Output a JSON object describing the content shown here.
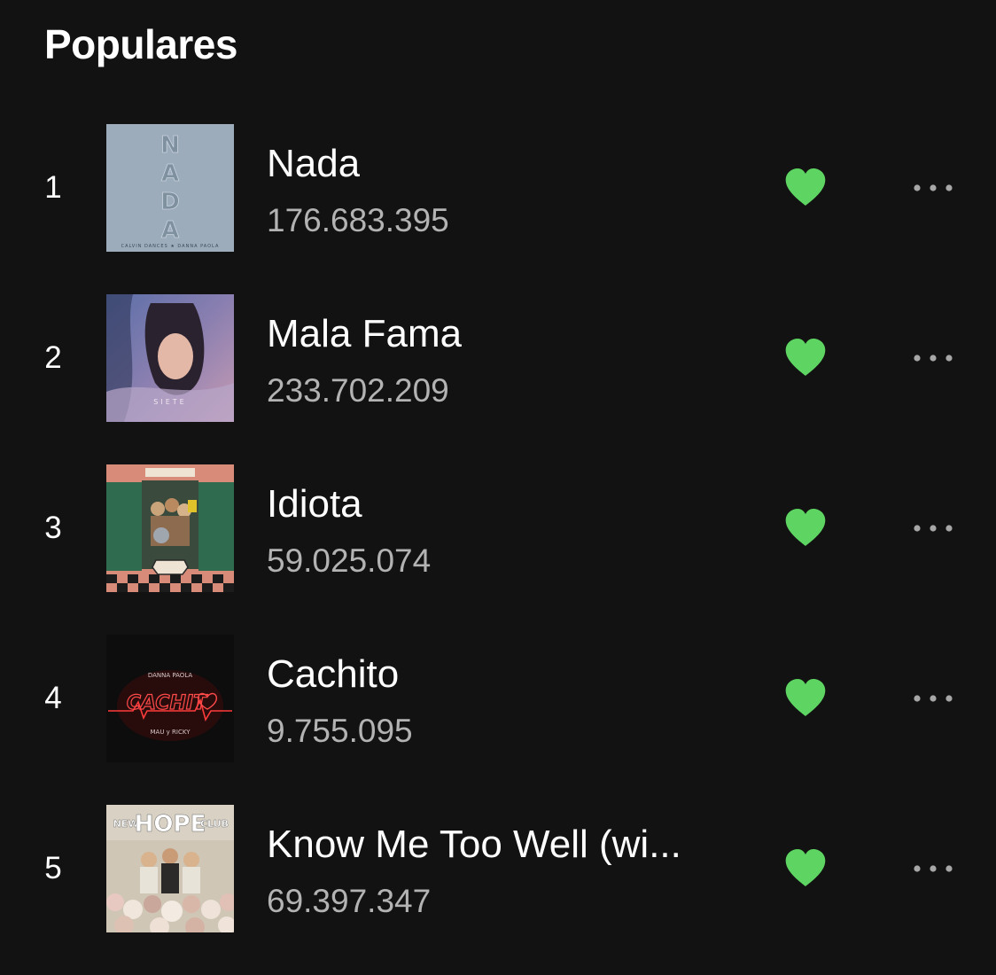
{
  "section": {
    "title": "Populares"
  },
  "colors": {
    "background": "#121212",
    "accent_green": "#5ed462",
    "secondary_text": "#b3b3b3",
    "more_dots": "#a7a7a7"
  },
  "tracks": [
    {
      "index": "1",
      "title": "Nada",
      "plays": "176.683.395",
      "liked": true,
      "cover": "nada-album-art"
    },
    {
      "index": "2",
      "title": "Mala Fama",
      "plays": "233.702.209",
      "liked": true,
      "cover": "siete-album-art"
    },
    {
      "index": "3",
      "title": "Idiota",
      "plays": "59.025.074",
      "liked": true,
      "cover": "morat-album-art"
    },
    {
      "index": "4",
      "title": "Cachito",
      "plays": "9.755.095",
      "liked": true,
      "cover": "cachito-album-art"
    },
    {
      "index": "5",
      "title": "Know Me Too Well (wi...",
      "plays": "69.397.347",
      "liked": true,
      "cover": "new-hope-club-album-art"
    }
  ]
}
